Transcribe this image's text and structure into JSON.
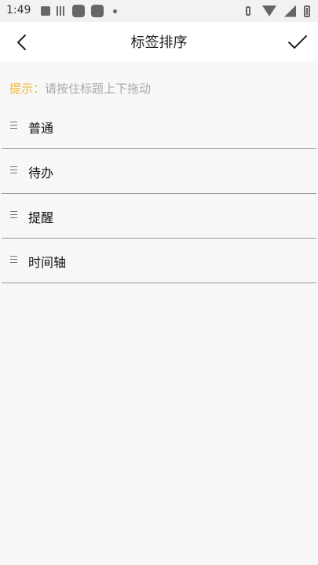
{
  "status_bar": {
    "time": "1:49",
    "left_icons": [
      "app-icon",
      "stripes-icon",
      "square-icon",
      "square-icon",
      "dot-icon"
    ],
    "right_icons": [
      "vibrate-icon",
      "wifi-icon",
      "signal-icon",
      "battery-icon"
    ]
  },
  "app_bar": {
    "title": "标签排序",
    "back_icon": "chevron-left-icon",
    "confirm_icon": "check-icon"
  },
  "hint": {
    "label": "提示：",
    "text": "请按住标题上下拖动"
  },
  "tags": [
    {
      "label": "普通"
    },
    {
      "label": "待办"
    },
    {
      "label": "提醒"
    },
    {
      "label": "时间轴"
    }
  ],
  "colors": {
    "hint_accent": "#f2b632",
    "hint_text": "#a9a9a9",
    "background": "#f8f8f8",
    "divider": "#999999"
  }
}
